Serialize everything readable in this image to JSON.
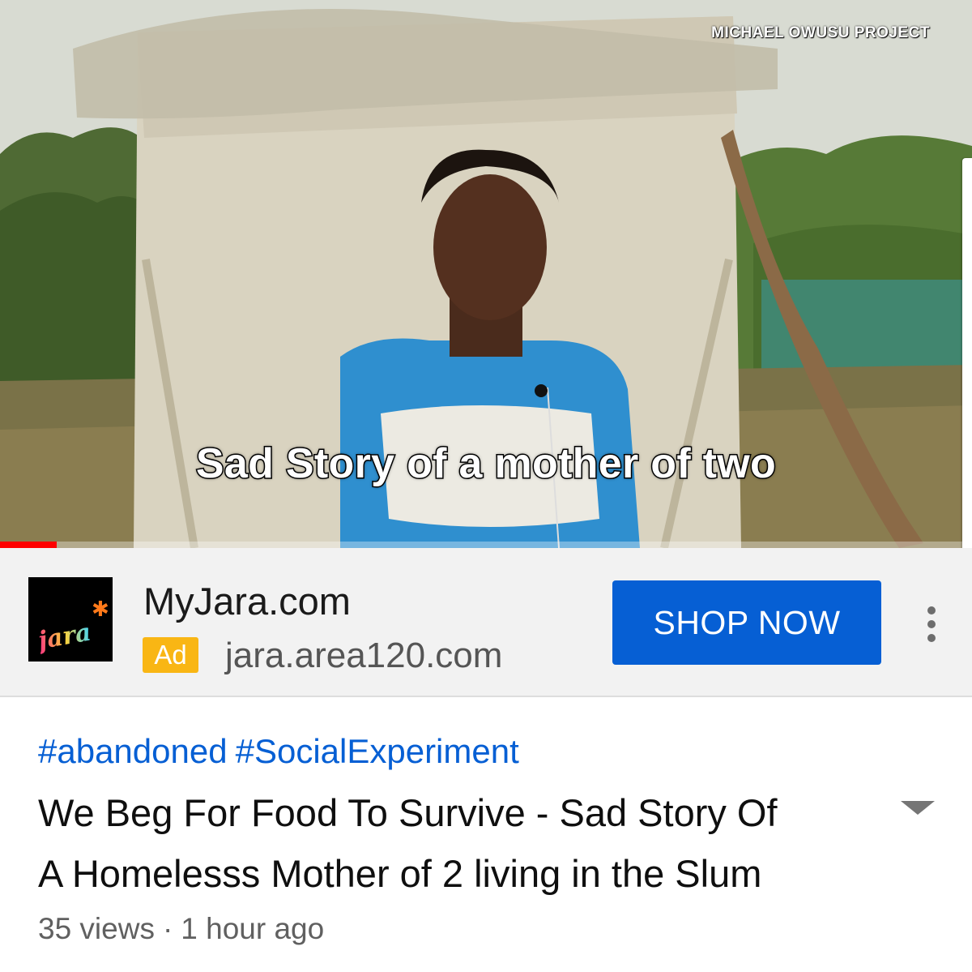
{
  "video": {
    "watermark": "MICHAEL OWUSU PROJECT",
    "caption": "Sad Story of a mother of two",
    "progress_fraction": 0.058
  },
  "ad": {
    "logo_text": "jara",
    "advertiser": "MyJara.com",
    "badge": "Ad",
    "domain": "jara.area120.com",
    "cta": "SHOP NOW"
  },
  "info": {
    "hashtags": [
      "#abandoned",
      "#SocialExperiment"
    ],
    "title_line1": "We Beg For Food To Survive - Sad Story Of",
    "title_line2": "A Homelesss Mother of 2 living in the Slum",
    "views": "35 views",
    "separator": "·",
    "age": "1 hour ago"
  },
  "colors": {
    "progress": "#ff0000",
    "cta": "#065fd4",
    "badge": "#f9b614",
    "hashtag": "#065fd4"
  },
  "icons": {
    "ad_menu": "more-vert-icon",
    "expand": "expand-triangle-icon"
  }
}
